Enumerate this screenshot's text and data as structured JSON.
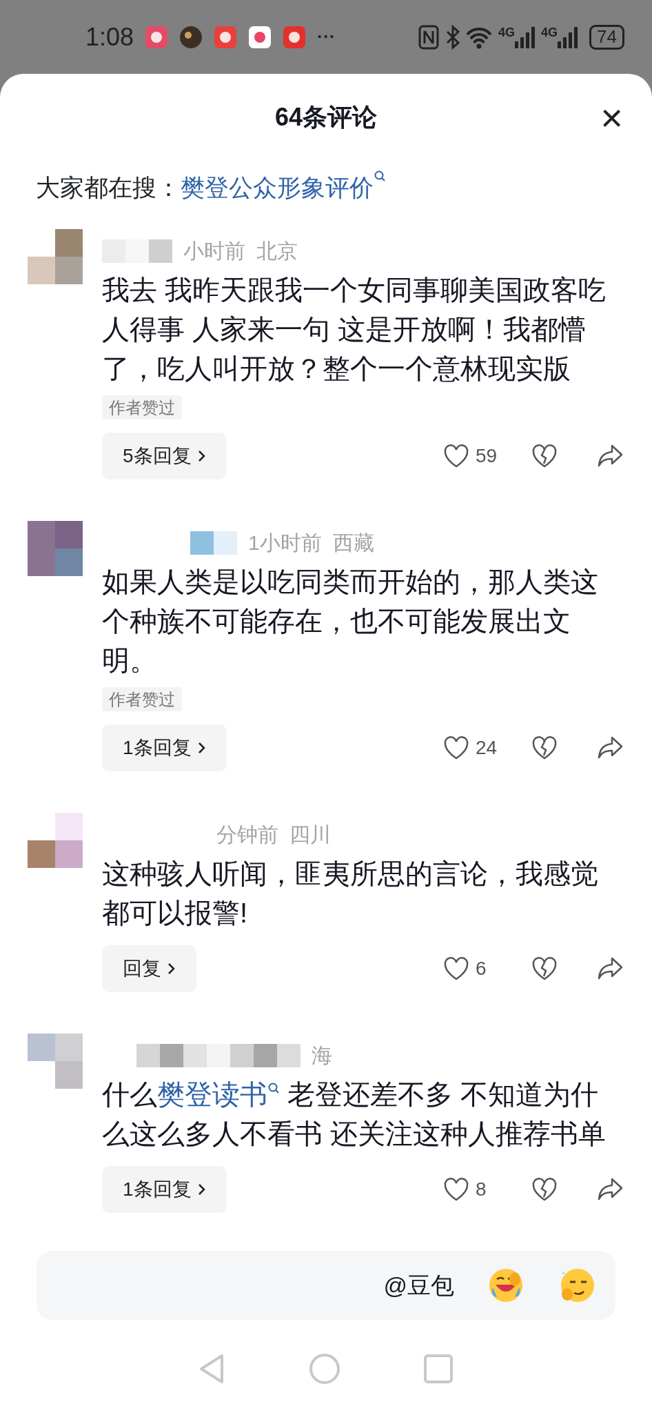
{
  "status_bar": {
    "time": "1:08",
    "overflow": "···",
    "network": [
      "4G",
      "4G"
    ],
    "battery": "74"
  },
  "header": {
    "title": "64条评论",
    "close": "×"
  },
  "search_suggestion": {
    "label": "大家都在搜：",
    "query": "樊登公众形象评价"
  },
  "comments": [
    {
      "meta": [
        "小时前",
        "北京"
      ],
      "body": [
        {
          "kind": "text",
          "text": "我去 我昨天跟我一个女同事聊美国政客吃人得事 人家来一句 这是开放啊！我都懵了，吃人叫开放？整个一个意林现实版"
        }
      ],
      "tag": "作者赞过",
      "replies": "5条回复",
      "likes": "59"
    },
    {
      "meta": [
        "1小时前",
        "西藏"
      ],
      "body": [
        {
          "kind": "text",
          "text": "如果人类是以吃同类而开始的，那人类这个种族不可能存在，也不可能发展出文明。"
        }
      ],
      "tag": "作者赞过",
      "replies": "1条回复",
      "likes": "24"
    },
    {
      "meta": [
        "分钟前",
        "四川"
      ],
      "body": [
        {
          "kind": "text",
          "text": "这种骇人听闻，匪夷所思的言论，我感觉都可以报警!"
        }
      ],
      "replies": "回复",
      "likes": "6"
    },
    {
      "meta": [
        "海"
      ],
      "body": [
        {
          "kind": "text",
          "text": "什么"
        },
        {
          "kind": "link",
          "text": "樊登读书"
        },
        {
          "kind": "text",
          "text": " 老登还差不多 不知道为什么这么多人不看书 还关注这种人推荐书单"
        }
      ],
      "replies": "1条回复",
      "likes": "8"
    }
  ],
  "input_bar": {
    "mention": "@豆包"
  }
}
